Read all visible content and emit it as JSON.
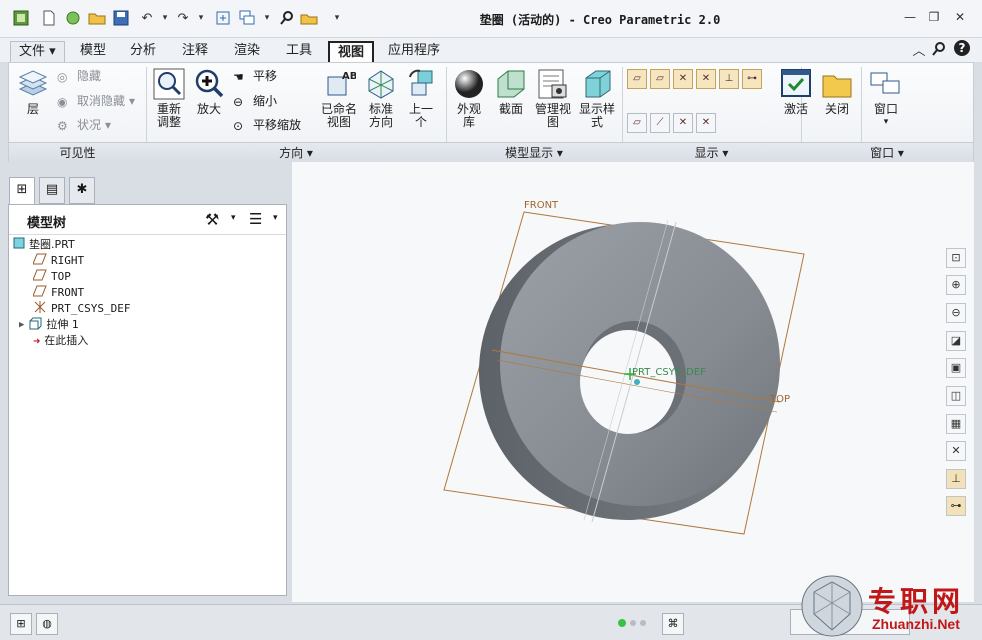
{
  "window": {
    "title": "垫圈 (活动的) - Creo Parametric 2.0"
  },
  "menu_tabs": [
    {
      "label": "文件 ▾"
    },
    {
      "label": "模型"
    },
    {
      "label": "分析"
    },
    {
      "label": "注释"
    },
    {
      "label": "渲染"
    },
    {
      "label": "工具"
    },
    {
      "label": "视图"
    },
    {
      "label": "应用程序"
    }
  ],
  "ribbon": {
    "visibility": {
      "layer": "层",
      "hide": "隐藏",
      "unhide": "取消隐藏",
      "status": "状况",
      "group": "可见性"
    },
    "orientation": {
      "refit": [
        "重新",
        "调整"
      ],
      "zoom_in": "放大",
      "pan": "平移",
      "zoom_out": "缩小",
      "pan_zoom": "平移缩放",
      "named_views": [
        "已命名",
        "视图"
      ],
      "standard": [
        "标准",
        "方向"
      ],
      "previous": [
        "上一",
        "个"
      ],
      "group": "方向 ▾"
    },
    "model_display": {
      "appearance": [
        "外观",
        "库"
      ],
      "section": "截面",
      "manage_views": [
        "管理视",
        "图"
      ],
      "display_style": [
        "显示样",
        "式"
      ],
      "group": "模型显示 ▾"
    },
    "show": {
      "group": "显示 ▾"
    },
    "window": {
      "activate": "激活",
      "close": "关闭",
      "window": "窗口",
      "group": "窗口 ▾"
    }
  },
  "model_tree": {
    "title": "模型树",
    "items": [
      {
        "label": "垫圈.PRT",
        "icon": "part-icon"
      },
      {
        "label": "RIGHT",
        "icon": "datum-plane-icon"
      },
      {
        "label": "TOP",
        "icon": "datum-plane-icon"
      },
      {
        "label": "FRONT",
        "icon": "datum-plane-icon"
      },
      {
        "label": "PRT_CSYS_DEF",
        "icon": "csys-icon"
      },
      {
        "label": "拉伸 1",
        "icon": "extrude-icon"
      },
      {
        "label": "在此插入",
        "icon": "insert-here-icon"
      }
    ]
  },
  "viewport": {
    "labels": {
      "front": "FRONT",
      "csys": "PRT_CSYS_DEF",
      "top": "TOP"
    },
    "colors": {
      "part": "#8a8f96",
      "datum": "#b0773a"
    }
  },
  "watermark": {
    "text1": "专职网",
    "text2": "Zhuanzhi.Net"
  }
}
